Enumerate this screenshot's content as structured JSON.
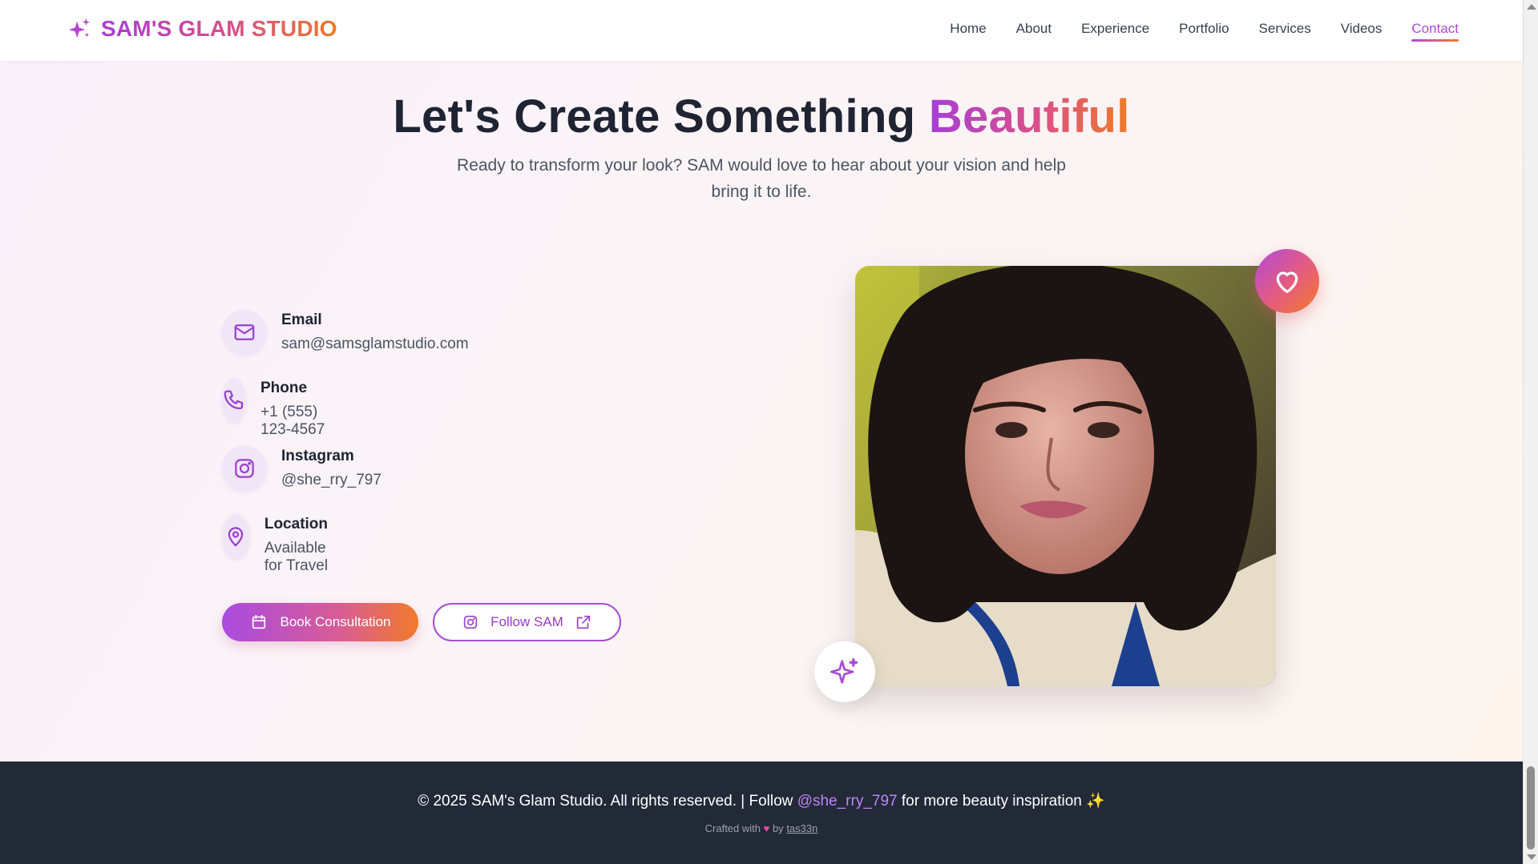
{
  "header": {
    "brand": "SAM'S GLAM STUDIO",
    "brand_icon": "sparkles-icon",
    "nav": [
      {
        "label": "Home",
        "active": false
      },
      {
        "label": "About",
        "active": false
      },
      {
        "label": "Experience",
        "active": false
      },
      {
        "label": "Portfolio",
        "active": false
      },
      {
        "label": "Services",
        "active": false
      },
      {
        "label": "Videos",
        "active": false
      },
      {
        "label": "Contact",
        "active": true
      }
    ]
  },
  "hero": {
    "title_main": "Let's Create Something ",
    "title_accent": "Beautiful",
    "subtitle": "Ready to transform your look? SAM would love to hear about your vision and help bring it to life."
  },
  "contact": {
    "items": [
      {
        "icon": "mail-icon",
        "label": "Email",
        "value": "sam@samsglamstudio.com"
      },
      {
        "icon": "phone-icon",
        "label": "Phone",
        "value": "+1 (555) 123-4567"
      },
      {
        "icon": "instagram-icon",
        "label": "Instagram",
        "value": "@she_rry_797"
      },
      {
        "icon": "map-pin-icon",
        "label": "Location",
        "value": "Available for Travel"
      }
    ],
    "book_button": "Book Consultation",
    "follow_button": "Follow SAM"
  },
  "photo": {
    "badge_top": "heart-icon",
    "badge_bottom": "sparkles-icon"
  },
  "footer": {
    "copyright_prefix": "© 2025 SAM's Glam Studio. All rights reserved. | Follow ",
    "handle": "@she_rry_797",
    "copyright_suffix": " for more beauty inspiration ✨",
    "crafted_prefix": "Crafted with ",
    "crafted_heart": "♥",
    "crafted_by": " by ",
    "author": "tas33n"
  },
  "colors": {
    "purple": "#a84bd6",
    "pink": "#d95c95",
    "orange": "#f27a2a",
    "footer_bg": "#222a38"
  }
}
